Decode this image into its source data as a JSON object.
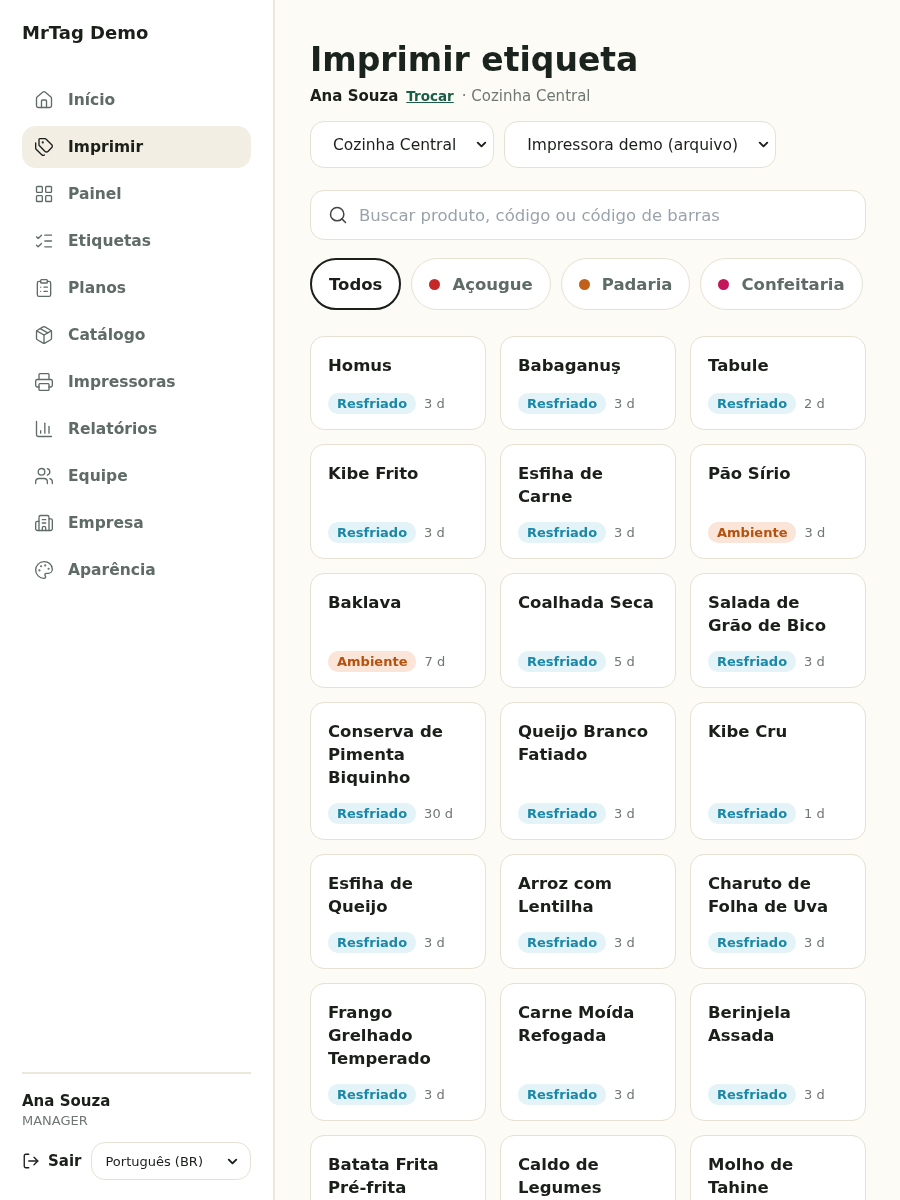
{
  "app_name": "MrTag Demo",
  "nav": [
    {
      "label": "Início",
      "selected": false
    },
    {
      "label": "Imprimir",
      "selected": true
    },
    {
      "label": "Painel",
      "selected": false
    },
    {
      "label": "Etiquetas",
      "selected": false
    },
    {
      "label": "Planos",
      "selected": false
    },
    {
      "label": "Catálogo",
      "selected": false
    },
    {
      "label": "Impressoras",
      "selected": false
    },
    {
      "label": "Relatórios",
      "selected": false
    },
    {
      "label": "Equipe",
      "selected": false
    },
    {
      "label": "Empresa",
      "selected": false
    },
    {
      "label": "Aparência",
      "selected": false
    }
  ],
  "user": {
    "name": "Ana Souza",
    "role": "MANAGER",
    "logout": "Sair",
    "language": "Português (BR)"
  },
  "page": {
    "title": "Imprimir etiqueta",
    "operator": "Ana Souza",
    "switch_link": "Trocar",
    "location": "· Cozinha Central"
  },
  "selects": [
    "Cozinha Central",
    "Impressora demo (arquivo)"
  ],
  "search": {
    "placeholder": "Buscar produto, código ou código de barras"
  },
  "categories": [
    {
      "label": "Todos",
      "selected": true
    },
    {
      "label": "Açougue",
      "color": "#c62828",
      "selected": false
    },
    {
      "label": "Padaria",
      "color": "#c2601a",
      "selected": false
    },
    {
      "label": "Confeitaria",
      "color": "#c2185b",
      "selected": false
    }
  ],
  "products": [
    {
      "name": "Homus",
      "kind": "chilled",
      "storage": "Resfriado",
      "shelf_life": "3 d"
    },
    {
      "name": "Babaganuş",
      "kind": "chilled",
      "storage": "Resfriado",
      "shelf_life": "3 d"
    },
    {
      "name": "Tabule",
      "kind": "chilled",
      "storage": "Resfriado",
      "shelf_life": "2 d"
    },
    {
      "name": "Kibe Frito",
      "kind": "chilled",
      "storage": "Resfriado",
      "shelf_life": "3 d"
    },
    {
      "name": "Esfiha de Carne",
      "kind": "chilled",
      "storage": "Resfriado",
      "shelf_life": "3 d"
    },
    {
      "name": "Pão Sírio",
      "kind": "ambient",
      "storage": "Ambiente",
      "shelf_life": "3 d"
    },
    {
      "name": "Baklava",
      "kind": "ambient",
      "storage": "Ambiente",
      "shelf_life": "7 d"
    },
    {
      "name": "Coalhada Seca",
      "kind": "chilled",
      "storage": "Resfriado",
      "shelf_life": "5 d"
    },
    {
      "name": "Salada de Grão de Bico",
      "kind": "chilled",
      "storage": "Resfriado",
      "shelf_life": "3 d"
    },
    {
      "name": "Conserva de Pimenta Biquinho",
      "kind": "chilled",
      "storage": "Resfriado",
      "shelf_life": "30 d"
    },
    {
      "name": "Queijo Branco Fatiado",
      "kind": "chilled",
      "storage": "Resfriado",
      "shelf_life": "3 d"
    },
    {
      "name": "Kibe Cru",
      "kind": "chilled",
      "storage": "Resfriado",
      "shelf_life": "1 d"
    },
    {
      "name": "Esfiha de Queijo",
      "kind": "chilled",
      "storage": "Resfriado",
      "shelf_life": "3 d"
    },
    {
      "name": "Arroz com Lentilha",
      "kind": "chilled",
      "storage": "Resfriado",
      "shelf_life": "3 d"
    },
    {
      "name": "Charuto de Folha de Uva",
      "kind": "chilled",
      "storage": "Resfriado",
      "shelf_life": "3 d"
    },
    {
      "name": "Frango Grelhado Temperado",
      "kind": "chilled",
      "storage": "Resfriado",
      "shelf_life": "3 d"
    },
    {
      "name": "Carne Moída Refogada",
      "kind": "chilled",
      "storage": "Resfriado",
      "shelf_life": "3 d"
    },
    {
      "name": "Berinjela Assada",
      "kind": "chilled",
      "storage": "Resfriado",
      "shelf_life": "3 d"
    },
    {
      "name": "Batata Frita Pré-frita"
    },
    {
      "name": "Caldo de Legumes"
    },
    {
      "name": "Molho de Tahine"
    }
  ]
}
